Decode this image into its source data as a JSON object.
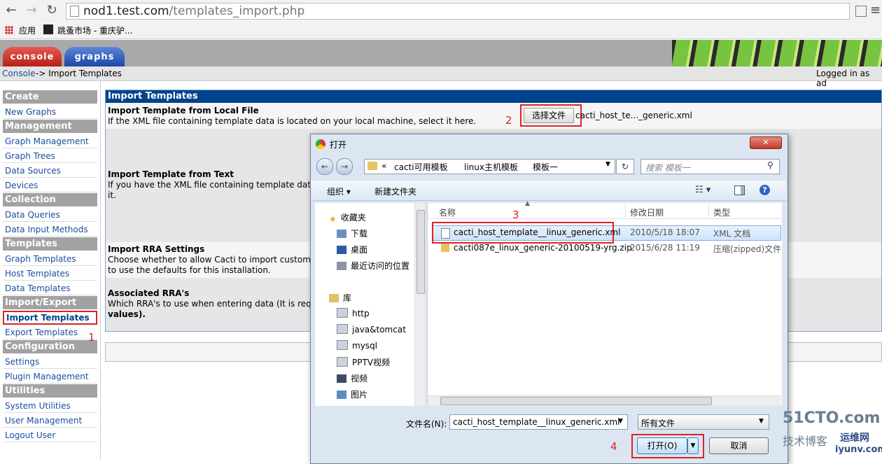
{
  "browser": {
    "url_host": "nod1.test.com",
    "url_path": "/templates_import.php",
    "bookmarks": [
      "应用",
      "跳蚤市场 - 重庆驴..."
    ]
  },
  "cacti": {
    "tabs": [
      "console",
      "graphs"
    ],
    "breadcrumb_link": "Console",
    "breadcrumb_rest": " -> Import Templates",
    "logged_in": "Logged in as ad",
    "sidebar": [
      {
        "type": "h",
        "label": "Create"
      },
      {
        "type": "i",
        "label": "New Graphs"
      },
      {
        "type": "h",
        "label": "Management"
      },
      {
        "type": "i",
        "label": "Graph Management"
      },
      {
        "type": "i",
        "label": "Graph Trees"
      },
      {
        "type": "i",
        "label": "Data Sources"
      },
      {
        "type": "i",
        "label": "Devices"
      },
      {
        "type": "h",
        "label": "Collection Methods"
      },
      {
        "type": "i",
        "label": "Data Queries"
      },
      {
        "type": "i",
        "label": "Data Input Methods"
      },
      {
        "type": "h",
        "label": "Templates"
      },
      {
        "type": "i",
        "label": "Graph Templates"
      },
      {
        "type": "i",
        "label": "Host Templates"
      },
      {
        "type": "i",
        "label": "Data Templates"
      },
      {
        "type": "h",
        "label": "Import/Export"
      },
      {
        "type": "i",
        "label": "Import Templates",
        "active": true
      },
      {
        "type": "i",
        "label": "Export Templates"
      },
      {
        "type": "h",
        "label": "Configuration"
      },
      {
        "type": "i",
        "label": "Settings"
      },
      {
        "type": "i",
        "label": "Plugin Management"
      },
      {
        "type": "h",
        "label": "Utilities"
      },
      {
        "type": "i",
        "label": "System Utilities"
      },
      {
        "type": "i",
        "label": "User Management"
      },
      {
        "type": "i",
        "label": "Logout User"
      }
    ],
    "main": {
      "header": "Import Templates",
      "file_title": "Import Template from Local File",
      "file_desc": "If the XML file containing template data is located on your local machine, select it here.",
      "choose_button": "选择文件",
      "chosen_file": "cacti_host_te..._generic.xml",
      "text_title": "Import Template from Text",
      "text_desc1": "If you have the XML file containing template dat",
      "text_desc2": "it.",
      "rra_title": "Import RRA Settings",
      "rra_desc1": "Choose whether to allow Cacti to import custom",
      "rra_desc2": "to use the defaults for this installation.",
      "assoc_title": "Associated RRA's",
      "assoc_desc1": "Which RRA's to use when entering data (It is req",
      "assoc_desc2": "values)."
    }
  },
  "dialog": {
    "title": "打开",
    "path": [
      "«",
      "cacti可用模板",
      "linux主机模板",
      "模板一"
    ],
    "search_placeholder": "搜索 模板一",
    "organize": "组织 ▾",
    "new_folder": "新建文件夹",
    "tree": {
      "favorites": "收藏夹",
      "fav_items": [
        "下载",
        "桌面",
        "最近访问的位置"
      ],
      "library": "库",
      "lib_items": [
        "http",
        "java&tomcat",
        "mysql",
        "PPTV视频",
        "视频",
        "图片"
      ]
    },
    "columns": {
      "name": "名称",
      "date": "修改日期",
      "type": "类型"
    },
    "files": [
      {
        "name": "cacti_host_template__linux_generic.xml",
        "date": "2010/5/18 18:07",
        "type": "XML 文档"
      },
      {
        "name": "cacti087e_linux_generic-20100519-yrg.zip",
        "date": "2015/6/28 11:19",
        "type": "压缩(zipped)文件"
      }
    ],
    "filename_label": "文件名(N):",
    "filename_value": "cacti_host_template__linux_generic.xml",
    "filetype_value": "所有文件",
    "open_button": "打开(O)",
    "cancel_button": "取消"
  },
  "annotations": [
    "1",
    "2",
    "3",
    "4"
  ],
  "watermark": {
    "line1": "51CTO.com",
    "line2": "技术博客",
    "line3": "运维网",
    "line4": "iyunv.com"
  }
}
